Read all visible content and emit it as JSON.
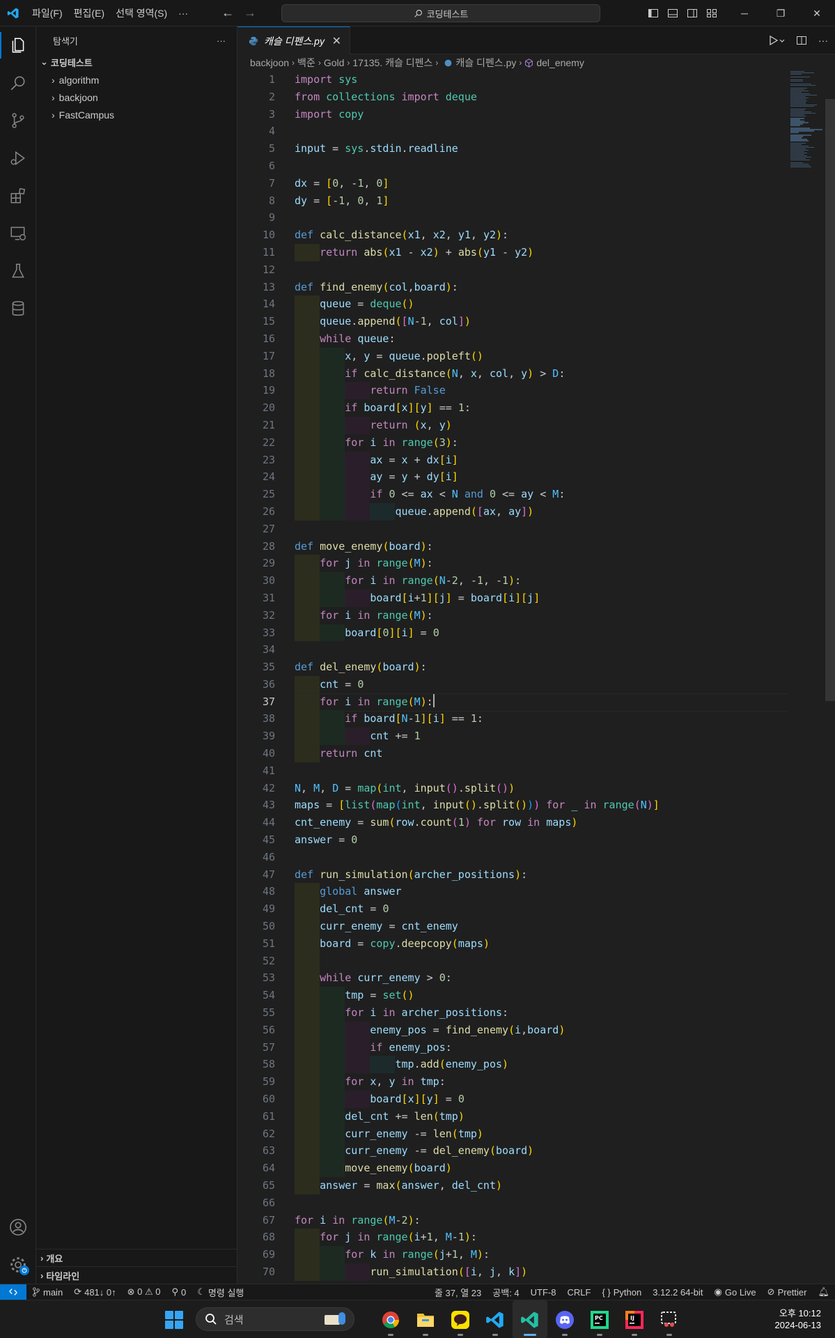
{
  "titlebar": {
    "menus": [
      "파일(F)",
      "편집(E)",
      "선택 영역(S)"
    ],
    "more": "···",
    "search": "코딩테스트",
    "window_buttons": [
      "─",
      "❐",
      "✕"
    ]
  },
  "sidebar": {
    "title": "탐색기",
    "more": "···",
    "root": "코딩테스트",
    "items": [
      {
        "label": "algorithm"
      },
      {
        "label": "backjoon"
      },
      {
        "label": "FastCampus"
      }
    ],
    "bottom": [
      "개요",
      "타임라인"
    ]
  },
  "tab": {
    "label": "캐슬 디펜스.py",
    "close": "✕"
  },
  "breadcrumb": [
    "backjoon",
    "백준",
    "Gold",
    "17135. 캐슬 디펜스",
    "캐슬 디펜스.py",
    "del_enemy"
  ],
  "editor": {
    "current_line": 37
  },
  "statusbar": {
    "branch": "main",
    "sync": "481↓ 0↑",
    "problems": "⊗ 0 ⚠ 0",
    "ports": "0",
    "command": "명령 실행",
    "position": "줄 37, 열 23",
    "spaces": "공백: 4",
    "encoding": "UTF-8",
    "eol": "CRLF",
    "language": "Python",
    "interpreter": "3.12.2 64-bit",
    "golive": "Go Live",
    "prettier": "Prettier"
  },
  "taskbar": {
    "search_placeholder": "검색",
    "time": "오후 10:12",
    "date": "2024-06-13"
  },
  "colors": {
    "accent": "#0078d4",
    "background": "#1f1f1f"
  }
}
